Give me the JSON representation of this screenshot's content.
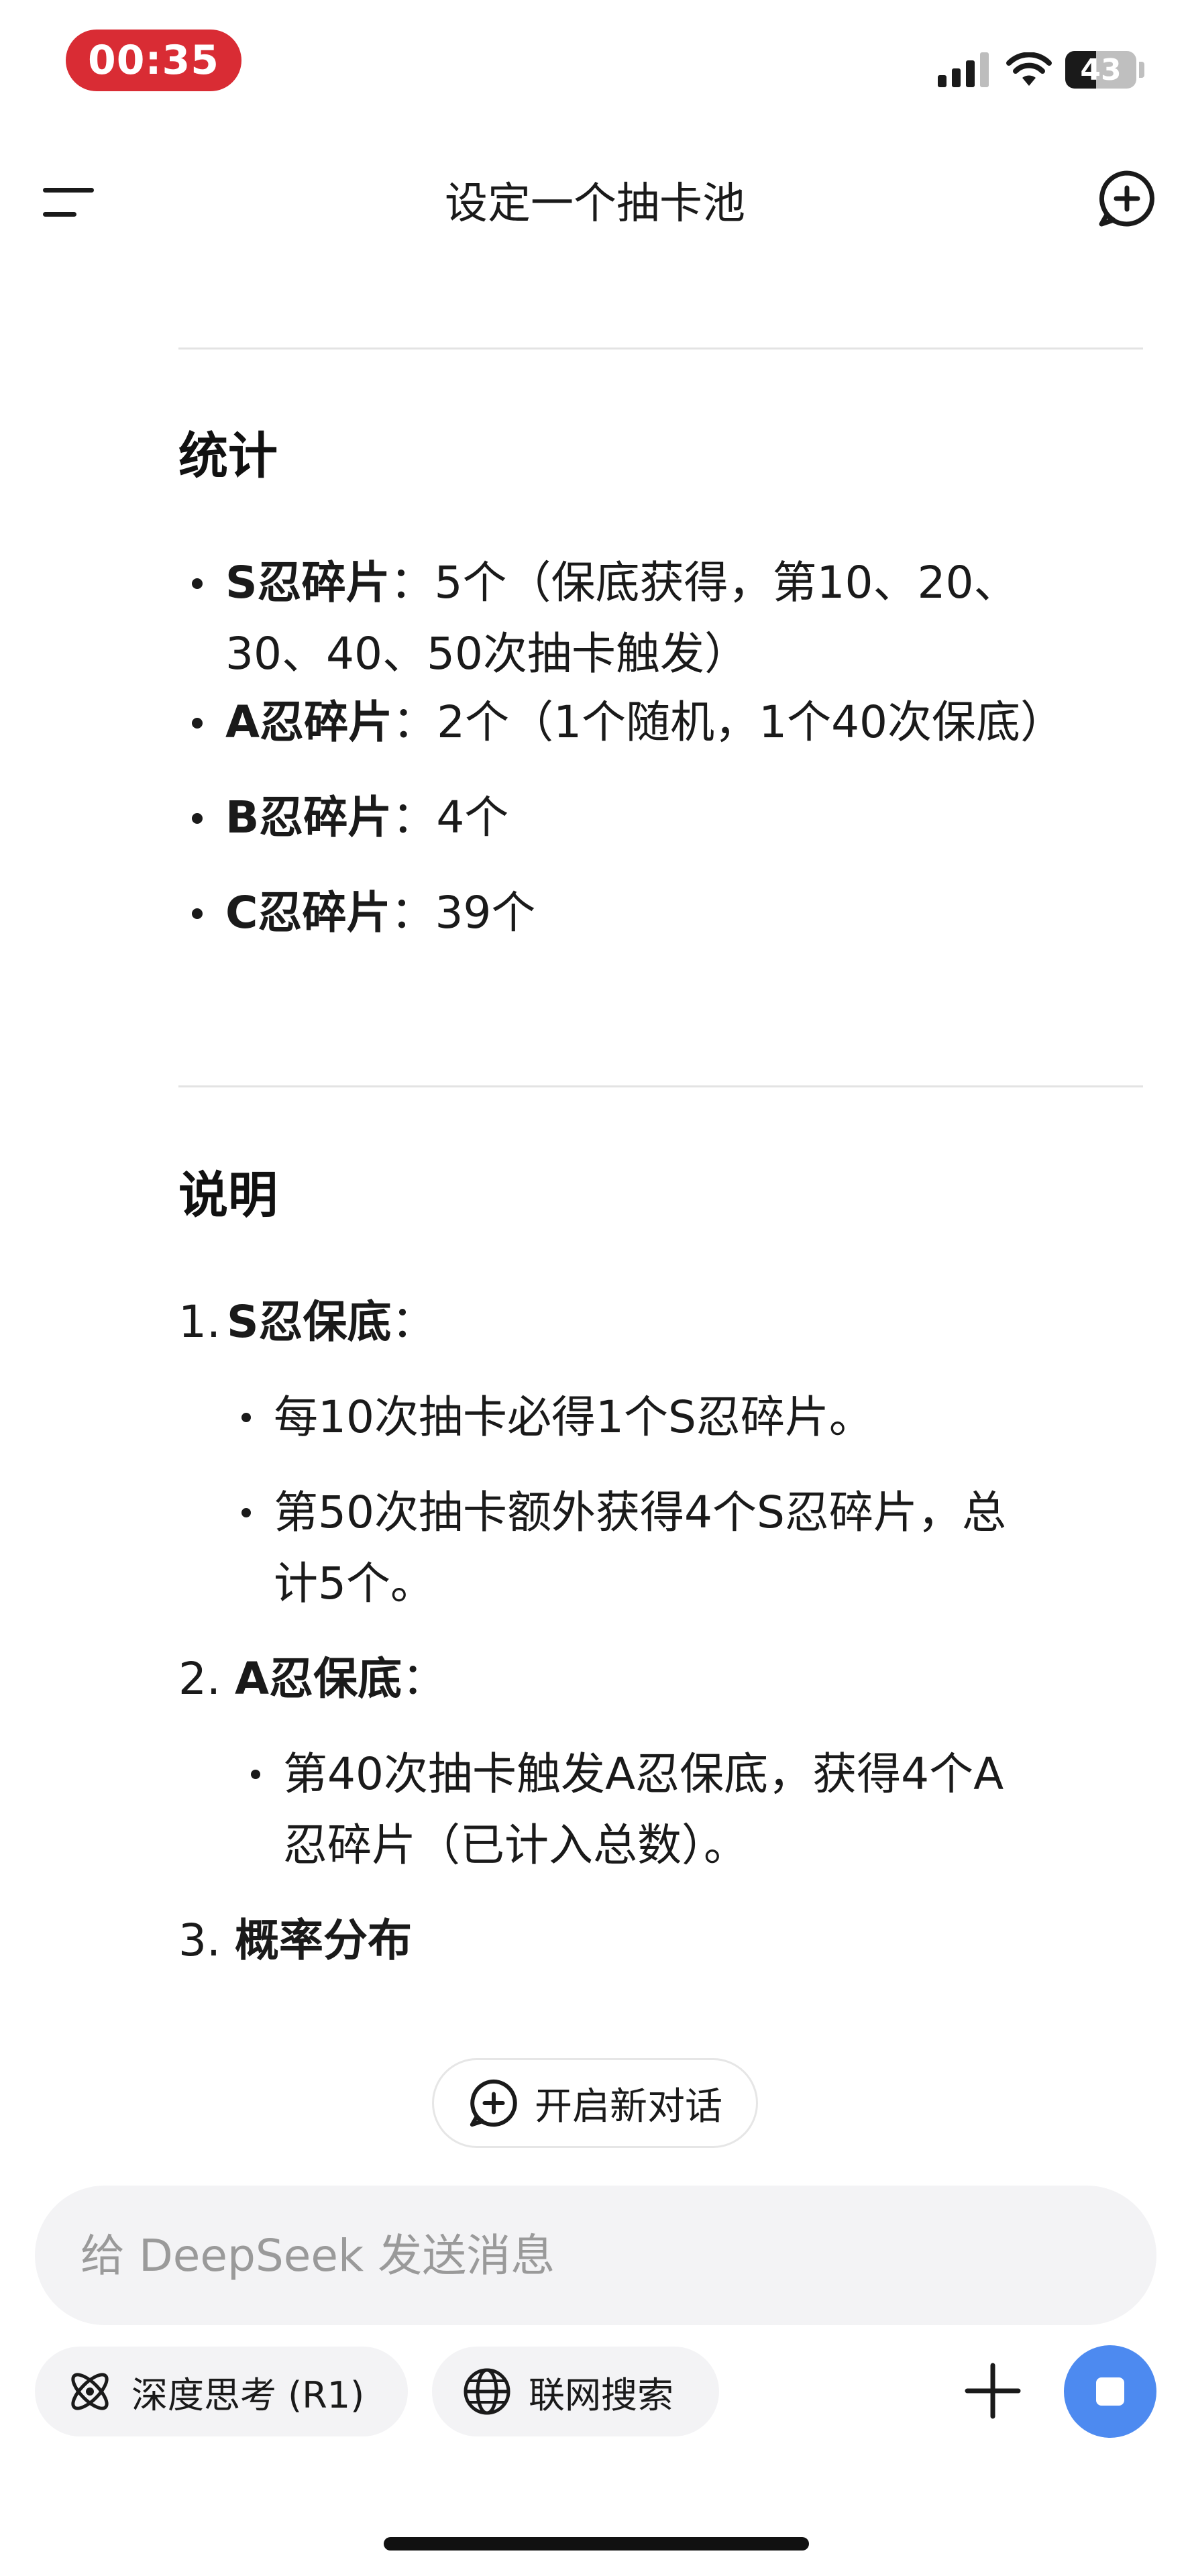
{
  "status_bar": {
    "time": "00:35",
    "battery_level": "43",
    "battery_fraction": 0.43
  },
  "header": {
    "title": "设定一个抽卡池",
    "menu_icon": "hamburger-menu-icon",
    "new_chat_icon": "chat-plus-icon"
  },
  "stats": {
    "heading": "统计",
    "items": [
      {
        "label": "S忍碎片",
        "sep": "：",
        "line1": "5个（保底获得，第10、20、",
        "line2": "30、40、50次抽卡触发）"
      },
      {
        "label": "A忍碎片",
        "sep": "：",
        "line1": "2个（1个随机，1个40次保底）"
      },
      {
        "label": "B忍碎片",
        "sep": "：",
        "line1": "4个"
      },
      {
        "label": "C忍碎片",
        "sep": "：",
        "line1": "39个"
      }
    ]
  },
  "notes": {
    "heading": "说明",
    "items": [
      {
        "num": "1.",
        "title": "S忍保底",
        "sep": "：",
        "subs": [
          {
            "line1": "每10次抽卡必得1个S忍碎片。"
          },
          {
            "line1": "第50次抽卡额外获得4个S忍碎片，总",
            "line2": "计5个。"
          }
        ]
      },
      {
        "num": "2.",
        "title": "A忍保底",
        "sep": "：",
        "subs": [
          {
            "line1": "第40次抽卡触发A忍保底，获得4个A",
            "line2": "忍碎片（已计入总数）。"
          }
        ]
      },
      {
        "num": "3.",
        "title": "概率分布"
      }
    ]
  },
  "new_chat_chip": {
    "label": "开启新对话",
    "icon": "chat-plus-icon"
  },
  "composer": {
    "placeholder": "给 DeepSeek 发送消息",
    "value": "",
    "deep_think_label": "深度思考 (R1)",
    "deep_think_icon": "atom-icon",
    "web_search_label": "联网搜索",
    "web_search_icon": "globe-icon",
    "plus_icon": "plus-icon",
    "send_icon": "stop-icon",
    "accent_color": "#4d8af0"
  }
}
